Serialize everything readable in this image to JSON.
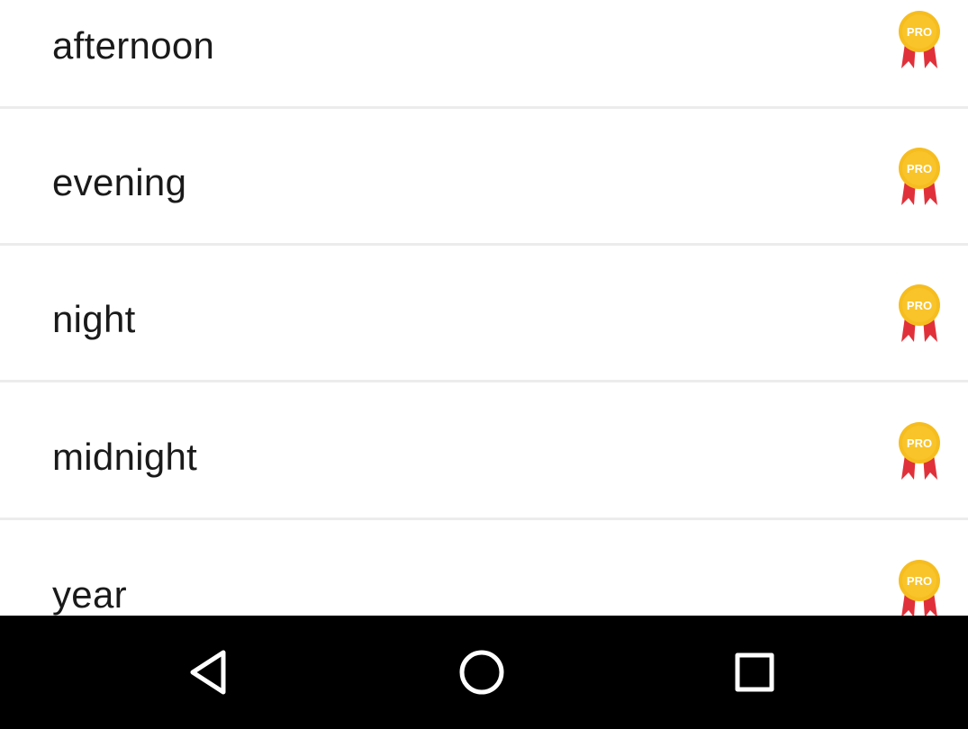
{
  "list": {
    "items": [
      {
        "label": "afternoon",
        "badge": "PRO"
      },
      {
        "label": "evening",
        "badge": "PRO"
      },
      {
        "label": "night",
        "badge": "PRO"
      },
      {
        "label": "midnight",
        "badge": "PRO"
      },
      {
        "label": "year",
        "badge": "PRO"
      }
    ]
  },
  "colors": {
    "badge_gold": "#f6bd1f",
    "badge_ribbon": "#e0313b",
    "navbar": "#000000",
    "divider": "#ececec",
    "text": "#1a1a1a"
  },
  "navbar": {
    "back_icon": "back-triangle-icon",
    "home_icon": "home-circle-icon",
    "recents_icon": "recents-square-icon"
  }
}
